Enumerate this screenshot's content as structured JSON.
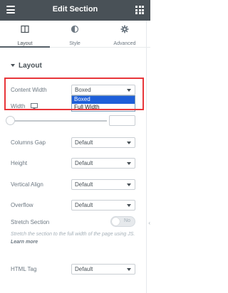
{
  "header": {
    "title": "Edit Section"
  },
  "tabs": [
    {
      "label": "Layout",
      "icon": "layout-icon",
      "active": true
    },
    {
      "label": "Style",
      "icon": "half-circle-icon",
      "active": false
    },
    {
      "label": "Advanced",
      "icon": "gear-icon",
      "active": false
    }
  ],
  "section": {
    "title": "Layout"
  },
  "controls": {
    "content_width": {
      "label": "Content Width",
      "value": "Boxed"
    },
    "width": {
      "label": "Width"
    },
    "columns_gap": {
      "label": "Columns Gap",
      "value": "Default"
    },
    "height": {
      "label": "Height",
      "value": "Default"
    },
    "vertical_align": {
      "label": "Vertical Align",
      "value": "Default"
    },
    "overflow": {
      "label": "Overflow",
      "value": "Default"
    },
    "stretch_section": {
      "label": "Stretch Section",
      "toggle_text": "No",
      "help_text": "Stretch the section to the full width of the page using JS.",
      "help_link": "Learn more"
    },
    "html_tag": {
      "label": "HTML Tag",
      "value": "Default"
    }
  },
  "dropdown": {
    "options": [
      "Boxed",
      "Full Width"
    ],
    "selected": "Boxed"
  },
  "side_toggle": {
    "glyph": "‹"
  },
  "colors": {
    "topbar": "#495157",
    "highlight": "#e8363a",
    "selected_option": "#1e5fd9"
  }
}
